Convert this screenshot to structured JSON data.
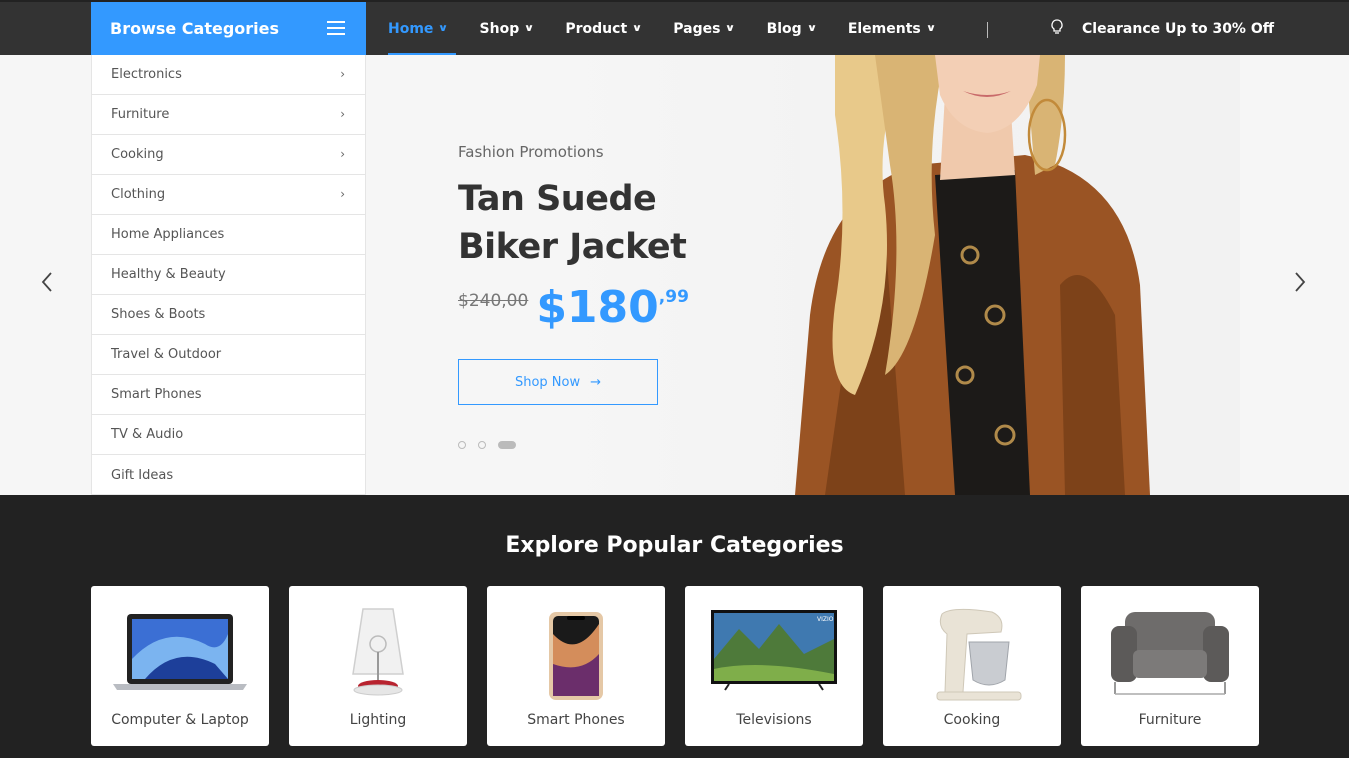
{
  "nav": {
    "browse_label": "Browse Categories",
    "items": [
      {
        "label": "Home",
        "active": true
      },
      {
        "label": "Shop"
      },
      {
        "label": "Product"
      },
      {
        "label": "Pages"
      },
      {
        "label": "Blog"
      },
      {
        "label": "Elements"
      }
    ],
    "promo_text": "Clearance Up to 30% Off",
    "accent_color": "#3399ff"
  },
  "sidebar": {
    "items": [
      {
        "label": "Electronics",
        "has_submenu": true
      },
      {
        "label": "Furniture",
        "has_submenu": true
      },
      {
        "label": "Cooking",
        "has_submenu": true
      },
      {
        "label": "Clothing",
        "has_submenu": true
      },
      {
        "label": "Home Appliances",
        "has_submenu": false
      },
      {
        "label": "Healthy & Beauty",
        "has_submenu": false
      },
      {
        "label": "Shoes & Boots",
        "has_submenu": false
      },
      {
        "label": "Travel & Outdoor",
        "has_submenu": false
      },
      {
        "label": "Smart Phones",
        "has_submenu": false
      },
      {
        "label": "TV & Audio",
        "has_submenu": false
      },
      {
        "label": "Gift Ideas",
        "has_submenu": false
      }
    ]
  },
  "hero": {
    "subtitle": "Fashion Promotions",
    "title_line1": "Tan Suede",
    "title_line2": "Biker Jacket",
    "old_price": "$240,00",
    "new_price": "$180",
    "cents": ",99",
    "button_label": "Shop Now",
    "slide_count": 3,
    "active_slide": 3
  },
  "categories": {
    "title": "Explore Popular Categories",
    "items": [
      {
        "label": "Computer & Laptop",
        "icon": "laptop-icon"
      },
      {
        "label": "Lighting",
        "icon": "lamp-icon"
      },
      {
        "label": "Smart Phones",
        "icon": "phone-icon"
      },
      {
        "label": "Televisions",
        "icon": "tv-icon"
      },
      {
        "label": "Cooking",
        "icon": "mixer-icon"
      },
      {
        "label": "Furniture",
        "icon": "armchair-icon"
      }
    ]
  },
  "tv_brand": "VIZIO"
}
